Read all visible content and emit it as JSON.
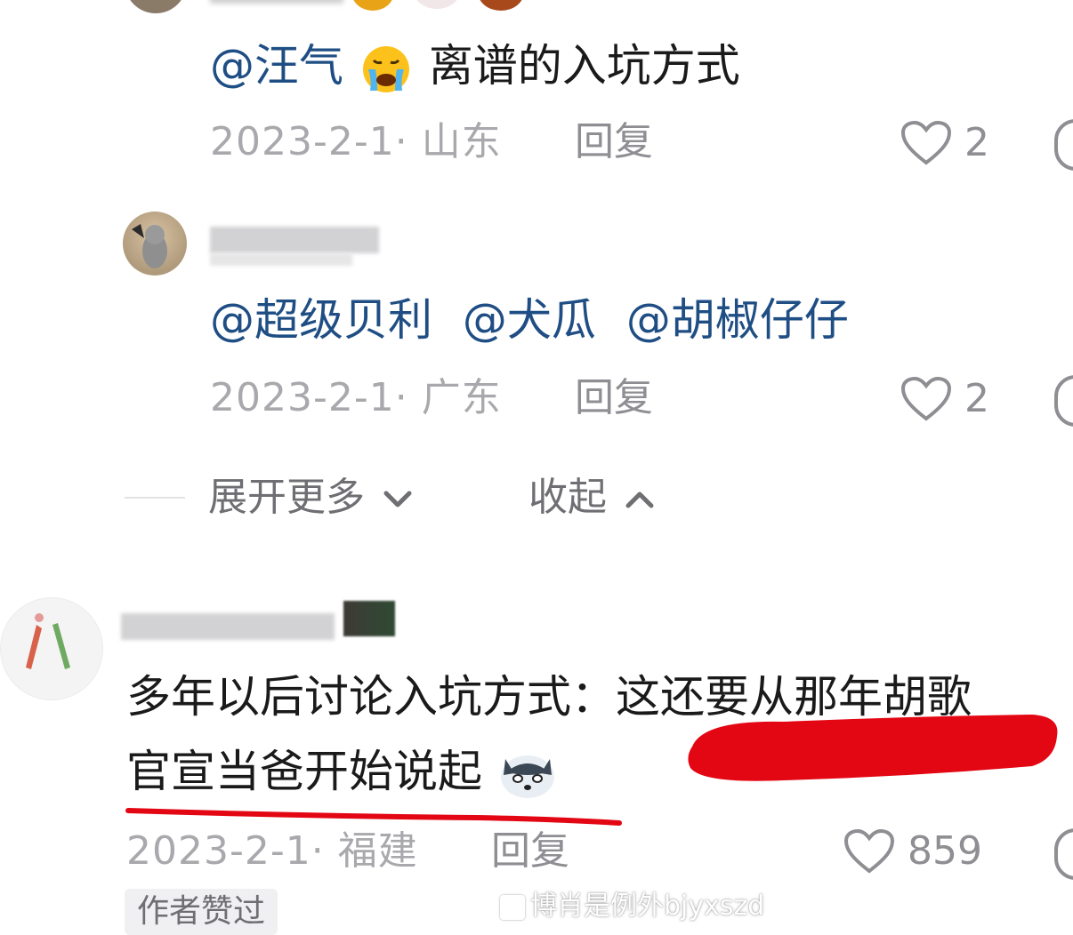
{
  "replies": [
    {
      "mention": "@汪气",
      "emoji_icon": "loudly-crying-face-icon",
      "text": "离谱的入坑方式",
      "date_location": "2023-2-1· 山东",
      "reply_label": "回复",
      "likes": "2"
    },
    {
      "mentions": [
        "@超级贝利",
        "@犬瓜",
        "@胡椒仔仔"
      ],
      "date_location": "2023-2-1· 广东",
      "reply_label": "回复",
      "likes": "2"
    }
  ],
  "thread_controls": {
    "expand_label": "展开更多",
    "collapse_label": "收起"
  },
  "top_comment": {
    "line1": "多年以后讨论入坑方式：这还要从那年胡歌",
    "line2": "官宣当爸开始说起",
    "emoji_icon": "doge-icon",
    "date_location": "2023-2-1· 福建",
    "reply_label": "回复",
    "likes": "859",
    "badge": "作者赞过"
  },
  "watermark": "博肖是例外bjyxszd",
  "colors": {
    "mention": "#1f4e84",
    "meta": "#a9a9ad",
    "annotation_red": "#e30613"
  }
}
